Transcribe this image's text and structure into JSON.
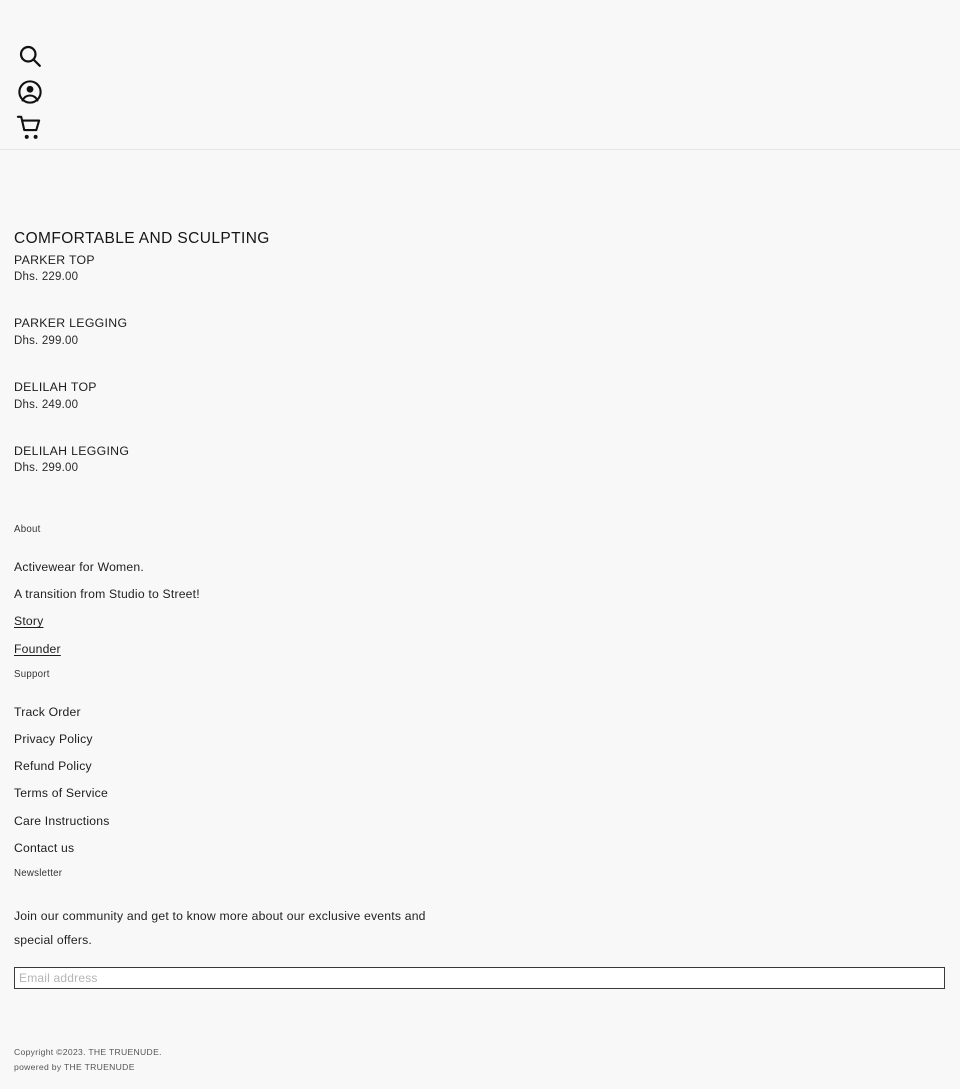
{
  "header": {
    "icons": [
      {
        "name": "search-icon",
        "label": "Search"
      },
      {
        "name": "account-icon",
        "label": "Account"
      },
      {
        "name": "cart-icon",
        "label": "Cart"
      }
    ]
  },
  "collection": {
    "title": "COMFORTABLE AND SCULPTING",
    "products": [
      {
        "name": "PARKER TOP",
        "price": "Dhs. 229.00"
      },
      {
        "name": "PARKER LEGGING",
        "price": "Dhs. 299.00"
      },
      {
        "name": "DELILAH TOP",
        "price": "Dhs. 249.00"
      },
      {
        "name": "DELILAH LEGGING",
        "price": "Dhs. 299.00"
      }
    ]
  },
  "footer": {
    "about": {
      "heading": "About",
      "line1": "Activewear for Women.",
      "line2": "A transition from Studio to Street!",
      "links": [
        {
          "label": "Story"
        },
        {
          "label": "Founder"
        }
      ]
    },
    "support": {
      "heading": "Support",
      "links": [
        {
          "label": "Track Order"
        },
        {
          "label": "Privacy Policy"
        },
        {
          "label": "Refund Policy"
        },
        {
          "label": "Terms of Service"
        },
        {
          "label": "Care Instructions"
        },
        {
          "label": "Contact us"
        }
      ]
    },
    "newsletter": {
      "heading": "Newsletter",
      "copy": "Join our community and get to know more about our exclusive events and special offers.",
      "email_placeholder": "Email address",
      "email_value": ""
    },
    "copyright": {
      "line1": "Copyright ©2023. THE TRUENUDE.",
      "line2": "powered by THE TRUENUDE"
    }
  },
  "colors": {
    "background": "#f8f8f8",
    "text": "#1a1a1a",
    "muted": "#555555",
    "border": "#3a3a3a",
    "divider": "#e6e6e6"
  }
}
